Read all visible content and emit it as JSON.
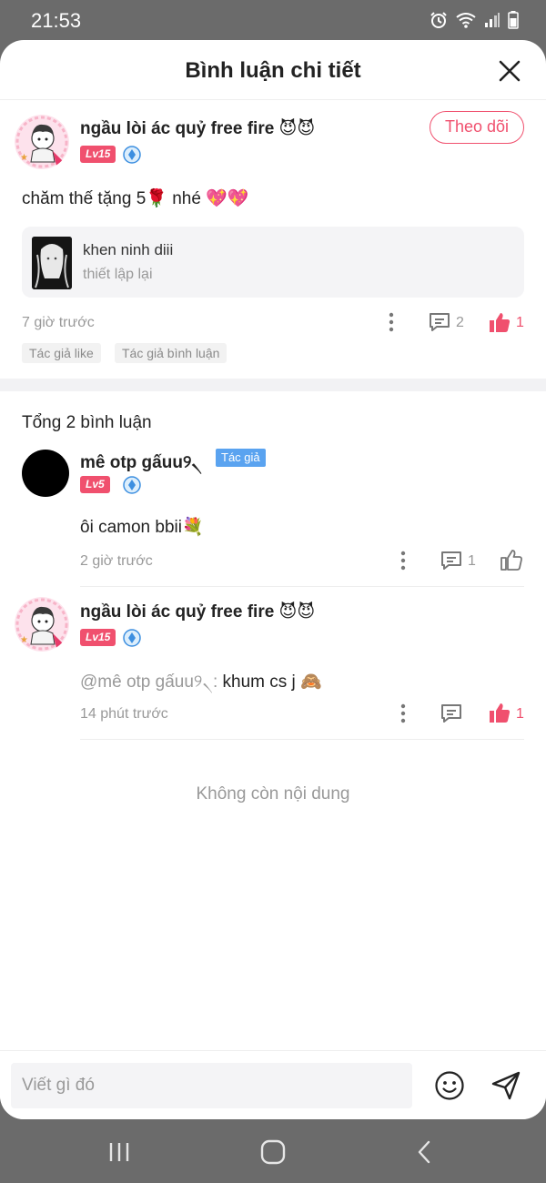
{
  "status": {
    "time": "21:53"
  },
  "header": {
    "title": "Bình luận chi tiết"
  },
  "main_comment": {
    "username": "ngầu lòi ác quỷ free fire 😈😈",
    "level": "Lv15",
    "follow_label": "Theo dõi",
    "text": "chăm thế tặng 5🌹 nhé 💖💖",
    "ref_title": "khen ninh diii",
    "ref_subtitle": "thiết lập lại",
    "time": "7 giờ trước",
    "reply_count": "2",
    "like_count": "1",
    "tags": [
      "Tác giả like",
      "Tác giả bình luận"
    ]
  },
  "replies_section": {
    "total_label": "Tổng 2 bình luận",
    "replies": [
      {
        "username": "mê otp gấuu୨৲",
        "author_tag": "Tác giả",
        "level": "Lv5",
        "text": "ôi camon bbii💐",
        "time": "2 giờ trước",
        "reply_count": "1"
      },
      {
        "username": "ngầu lòi ác quỷ free fire 😈😈",
        "level": "Lv15",
        "mention": "@mê otp gấuu୨৲:",
        "text": " khum cs j 🙈",
        "time": "14 phút trước",
        "like_count": "1"
      }
    ],
    "end_label": "Không còn nội dung"
  },
  "composer": {
    "placeholder": "Viết gì đó"
  },
  "colors": {
    "accent": "#f0506e",
    "author_tag": "#5aa3f0",
    "muted": "#999999"
  }
}
